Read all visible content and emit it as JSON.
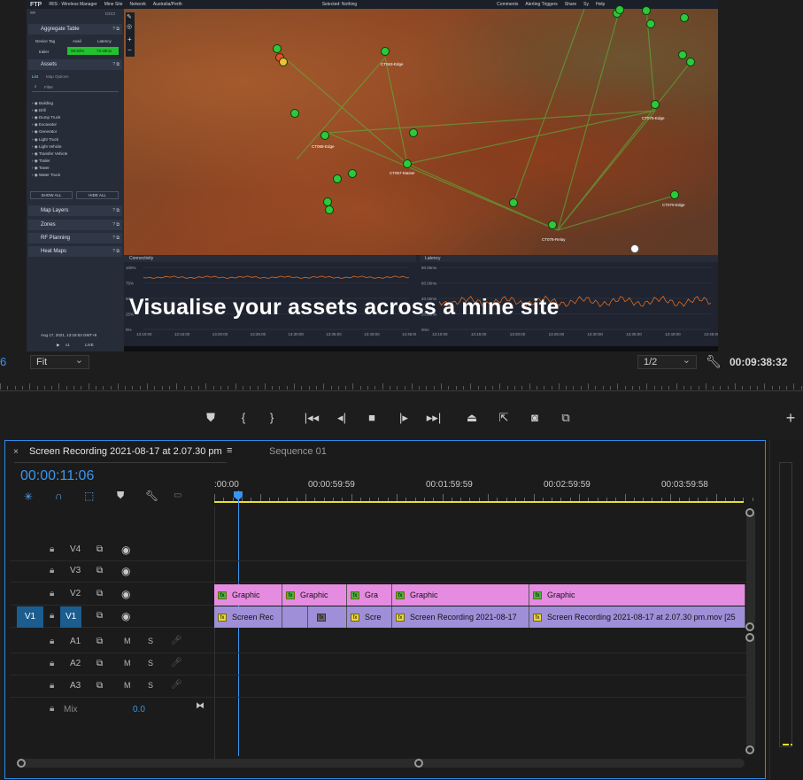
{
  "monitor": {
    "app_bar": {
      "logo": "FTP",
      "items": [
        "IRIS - Wireless Manager",
        "Mine Site",
        "Network",
        "Australia/Perth"
      ],
      "selected": "Selected: Nothing",
      "right_items": [
        "Comments",
        "Alerting Triggers",
        "Share",
        "Sy",
        "Help"
      ]
    },
    "sidebar": {
      "aggregate_table": "Aggregate Table",
      "cols": [
        "Device Tag",
        "Avail",
        "Latency"
      ],
      "row": [
        "trailer",
        "99.93%",
        "73.48ms"
      ],
      "assets": "Assets",
      "list_tab": "List",
      "map_options": "Map Options",
      "filter_placeholder": "Filter",
      "asset_types": [
        "Building",
        "Drill",
        "Dump Truck",
        "Excavator",
        "Generator",
        "Light Truck",
        "Light Vehicle",
        "Transfer Vehicle",
        "Trailer",
        "Tower",
        "Water Truck"
      ],
      "show_all": "SHOW ALL",
      "hide_all": "HIDE ALL",
      "sections": [
        "Map Layers",
        "Zones",
        "RF Planning",
        "Heat Maps"
      ],
      "timestamp": "Aug 17, 2021, 13:18:53 GMT+8",
      "playback": "x1",
      "live": "LIVE"
    },
    "map_labels": [
      "CT063-Edge",
      "CT068-Edge",
      "CT057-Master",
      "CT075-Edge",
      "CT070-Edge",
      "CT078-Relay"
    ],
    "charts": {
      "connectivity": "Connectivity",
      "latency": "Latency",
      "conn_y": [
        "100%",
        "75%",
        "50%",
        "25%",
        "0%"
      ],
      "lat_y": [
        "80.00ms",
        "60.00ms",
        "40.00ms",
        "20.00ms",
        "0ms"
      ],
      "conn_x": [
        "13:10:00",
        "13:15:00",
        "13:20:00",
        "13:25:00",
        "13:30:00",
        "13:35:00",
        "13:40:00",
        "13:45:00"
      ],
      "lat_x": [
        "13:10:00",
        "13:15:00",
        "13:20:00",
        "13:25:00",
        "13:30:00",
        "13:35:00",
        "13:40:00",
        "13:45:00"
      ]
    },
    "caption": "Visualise your assets across a mine site"
  },
  "monitor_controls": {
    "left_num": "6",
    "zoom": "Fit",
    "resolution": "1/2",
    "timecode": "00:09:38:32"
  },
  "transport": {
    "add_marker": "marker",
    "buttons": [
      "add-marker",
      "mark-in",
      "mark-out",
      "go-to-in",
      "step-back",
      "stop",
      "step-forward",
      "go-to-out",
      "lift",
      "extract",
      "export-frame",
      "comparison"
    ],
    "add": "+"
  },
  "timeline": {
    "tab_active": "Screen Recording 2021-08-17 at 2.07.30 pm",
    "tab_inactive": "Sequence 01",
    "playhead_time": "00:00:11:06",
    "ruler_labels": [
      ":00:00",
      "00:00:59:59",
      "00:01:59:59",
      "00:02:59:59",
      "00:03:59:58"
    ],
    "video_tracks": [
      "V4",
      "V3",
      "V2",
      "V1"
    ],
    "audio_tracks": [
      "A1",
      "A2",
      "A3"
    ],
    "mix_label": "Mix",
    "mix_value": "0.0",
    "source_patch": "V1",
    "audio_btn_m": "M",
    "audio_btn_s": "S",
    "v2_clips": [
      "Graphic",
      "Graphic",
      "Gra",
      "Graphic",
      "Graphic"
    ],
    "v1_clips": [
      "Screen Rec",
      "",
      "",
      "Scre",
      "Screen Recording 2021-08-17",
      "Screen Recording 2021-08-17 at 2.07.30 pm.mov [25"
    ],
    "fx_label": "fx",
    "playhead_fraction": 0.045
  },
  "colors": {
    "accent_blue": "#2d8ceb",
    "graphic_clip": "#e58ce1",
    "video_clip": "#9f8fd8",
    "work_area": "#e7e22a"
  }
}
